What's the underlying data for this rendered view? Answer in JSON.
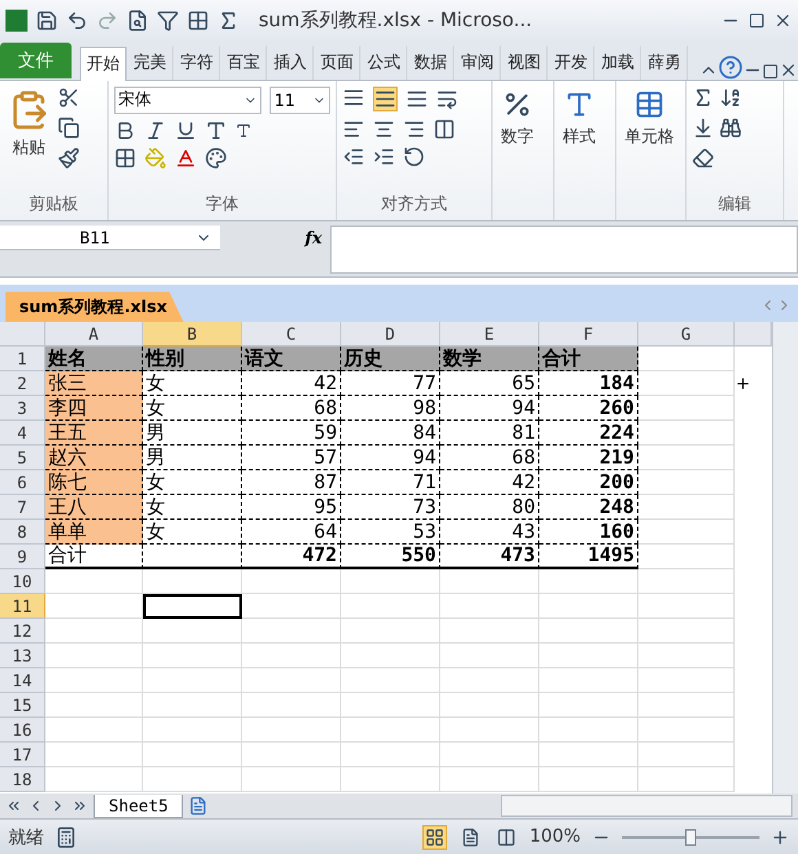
{
  "window": {
    "title": "sum系列教程.xlsx  -  Microso..."
  },
  "ribbon_tabs": [
    {
      "label": "文件",
      "kind": "file",
      "selected": false
    },
    {
      "label": "开始",
      "kind": "tab",
      "selected": true
    },
    {
      "label": "完美",
      "kind": "tab",
      "selected": false
    },
    {
      "label": "字符",
      "kind": "tab",
      "selected": false
    },
    {
      "label": "百宝",
      "kind": "tab",
      "selected": false
    },
    {
      "label": "插入",
      "kind": "tab",
      "selected": false
    },
    {
      "label": "页面",
      "kind": "tab",
      "selected": false
    },
    {
      "label": "公式",
      "kind": "tab",
      "selected": false
    },
    {
      "label": "数据",
      "kind": "tab",
      "selected": false
    },
    {
      "label": "审阅",
      "kind": "tab",
      "selected": false
    },
    {
      "label": "视图",
      "kind": "tab",
      "selected": false
    },
    {
      "label": "开发",
      "kind": "tab",
      "selected": false
    },
    {
      "label": "加载",
      "kind": "tab",
      "selected": false
    },
    {
      "label": "薛勇",
      "kind": "tab",
      "selected": false
    }
  ],
  "ribbon": {
    "paste": "粘贴",
    "font_name": "宋体",
    "font_size": "11",
    "number": "数字",
    "styles": "样式",
    "cells": "单元格",
    "groups": [
      "剪贴板",
      "字体",
      "对齐方式",
      "编辑"
    ]
  },
  "formula_bar": {
    "name_box": "B11",
    "fx": "fx"
  },
  "workbook_tab": "sum系列教程.xlsx",
  "sheet": {
    "columns": [
      {
        "label": "A",
        "selected": false
      },
      {
        "label": "B",
        "selected": true
      },
      {
        "label": "C",
        "selected": false
      },
      {
        "label": "D",
        "selected": false
      },
      {
        "label": "E",
        "selected": false
      },
      {
        "label": "F",
        "selected": false
      },
      {
        "label": "G",
        "selected": false
      }
    ],
    "row_numbers": [
      {
        "label": "1",
        "selected": false
      },
      {
        "label": "2",
        "selected": false
      },
      {
        "label": "3",
        "selected": false
      },
      {
        "label": "4",
        "selected": false
      },
      {
        "label": "5",
        "selected": false
      },
      {
        "label": "6",
        "selected": false
      },
      {
        "label": "7",
        "selected": false
      },
      {
        "label": "8",
        "selected": false
      },
      {
        "label": "9",
        "selected": false
      },
      {
        "label": "10",
        "selected": false
      },
      {
        "label": "11",
        "selected": true
      },
      {
        "label": "12",
        "selected": false
      },
      {
        "label": "13",
        "selected": false
      },
      {
        "label": "14",
        "selected": false
      },
      {
        "label": "15",
        "selected": false
      },
      {
        "label": "16",
        "selected": false
      },
      {
        "label": "17",
        "selected": false
      },
      {
        "label": "18",
        "selected": false
      }
    ],
    "rows": [
      {
        "kind": "header",
        "cells": [
          "姓名",
          "性别",
          "语文",
          "历史",
          "数学",
          "合计"
        ]
      },
      {
        "kind": "data",
        "cells": [
          "张三",
          "女",
          "42",
          "77",
          "65",
          "184"
        ]
      },
      {
        "kind": "data",
        "cells": [
          "李四",
          "女",
          "68",
          "98",
          "94",
          "260"
        ]
      },
      {
        "kind": "data",
        "cells": [
          "王五",
          "男",
          "59",
          "84",
          "81",
          "224"
        ]
      },
      {
        "kind": "data",
        "cells": [
          "赵六",
          "男",
          "57",
          "94",
          "68",
          "219"
        ]
      },
      {
        "kind": "data",
        "cells": [
          "陈七",
          "女",
          "87",
          "71",
          "42",
          "200"
        ]
      },
      {
        "kind": "data",
        "cells": [
          "王八",
          "女",
          "95",
          "73",
          "80",
          "248"
        ]
      },
      {
        "kind": "data",
        "cells": [
          "单单",
          "女",
          "64",
          "53",
          "43",
          "160"
        ]
      },
      {
        "kind": "total",
        "cells": [
          "合计",
          "",
          "472",
          "550",
          "473",
          "1495"
        ]
      }
    ]
  },
  "sheet_tabs": [
    {
      "label": "Sheet5",
      "selected": true
    }
  ],
  "status_bar": {
    "status": "就绪",
    "zoom": "100%",
    "zoom_level": {
      "level": 0.5
    }
  }
}
